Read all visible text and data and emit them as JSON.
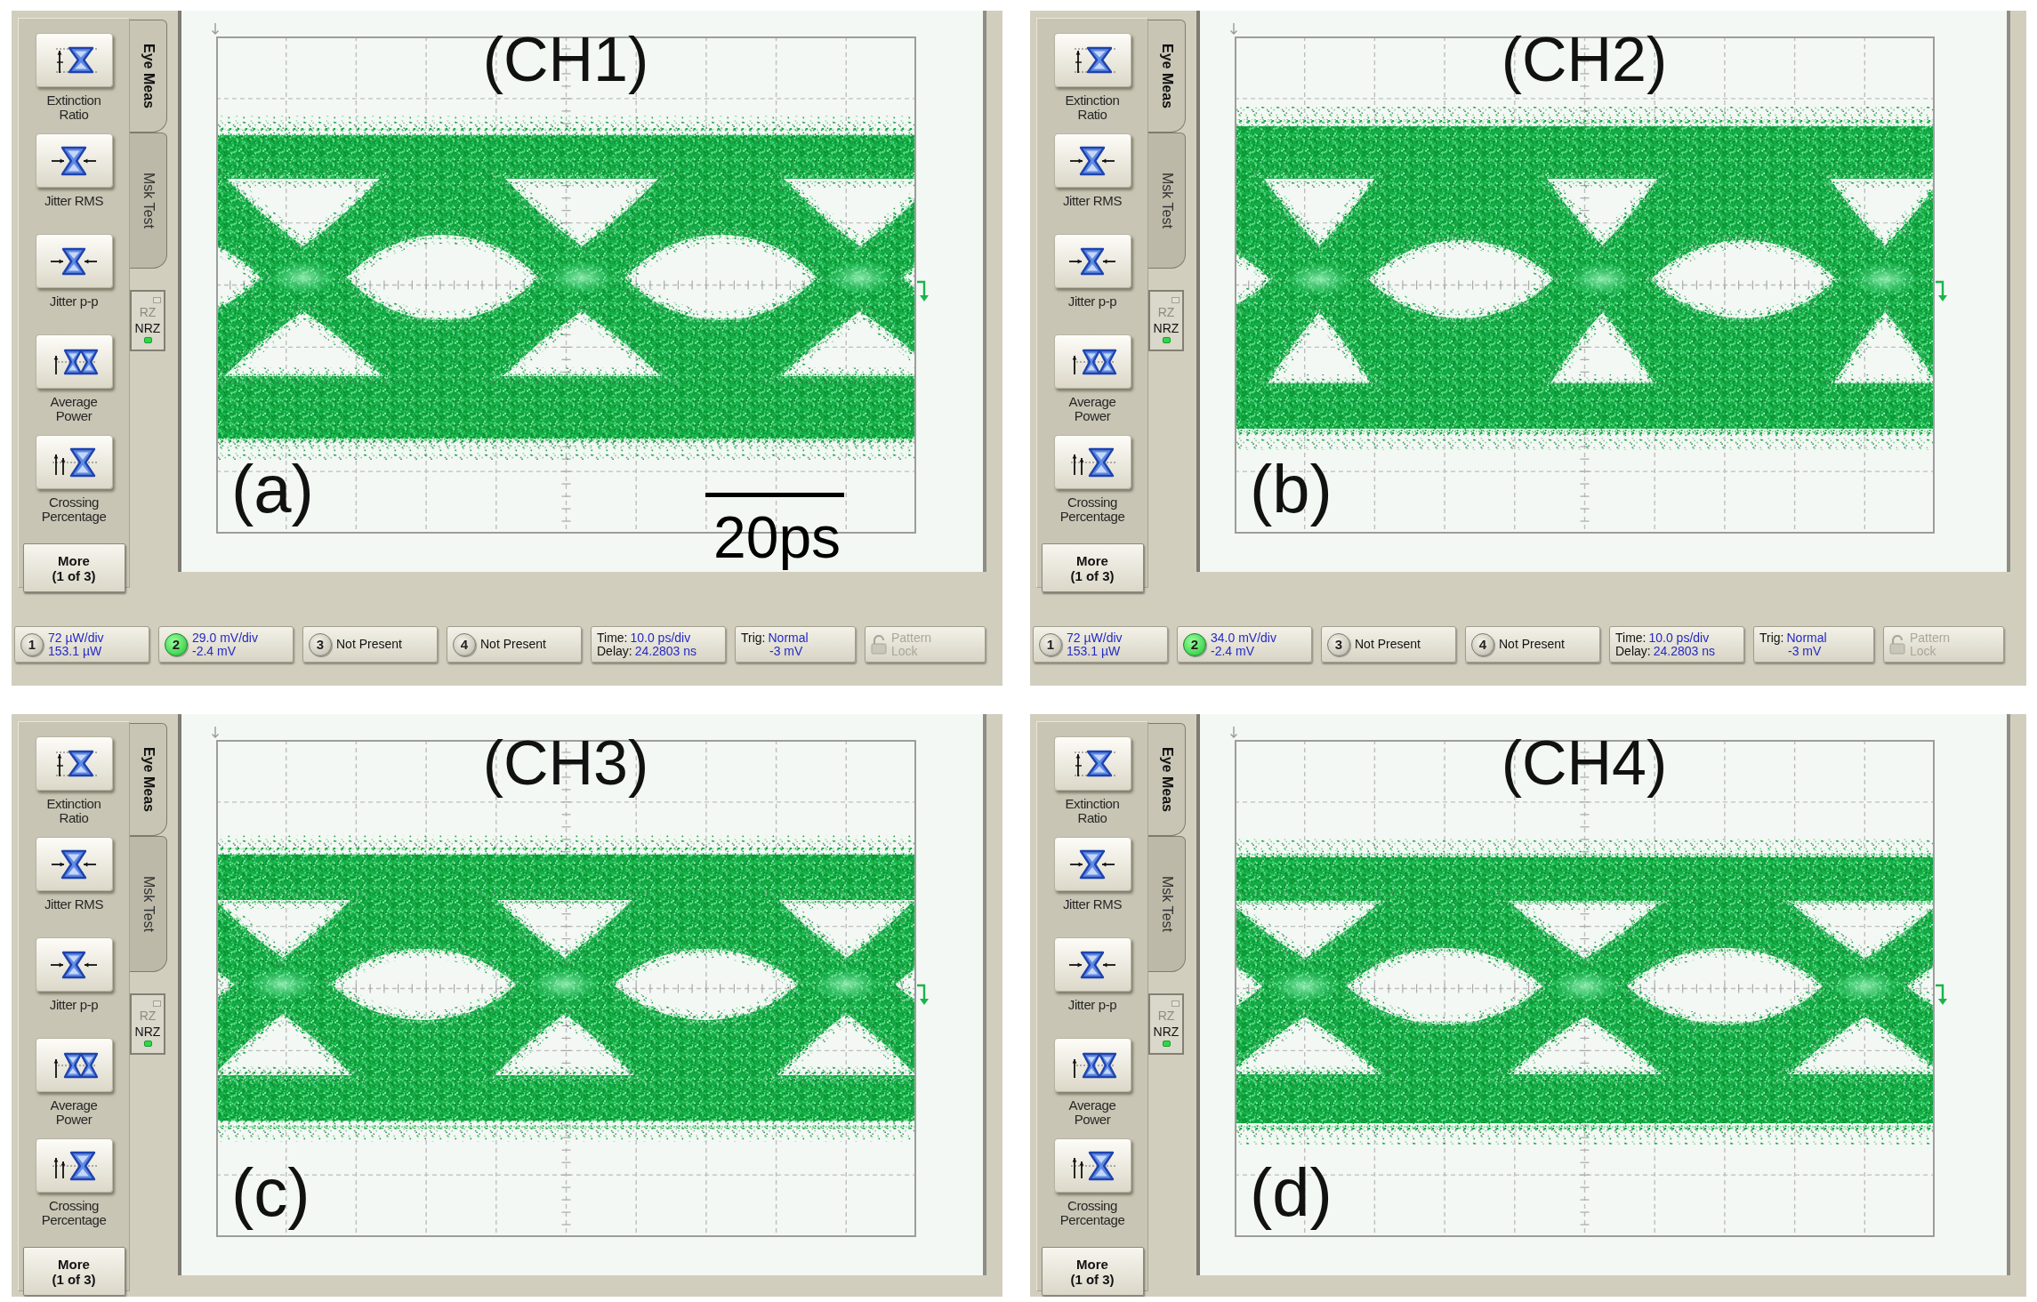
{
  "panels": [
    {
      "title": "(CH1)",
      "label": "(a)",
      "scale_bar": "20ps",
      "measurements": [
        {
          "label": "Extinction\nRatio"
        },
        {
          "label": "Jitter RMS"
        },
        {
          "label": "Jitter p-p"
        },
        {
          "label": "Average\nPower"
        },
        {
          "label": "Crossing\nPercentage"
        }
      ],
      "more_button": "More\n(1 of 3)",
      "tabs": [
        {
          "label": "Eye Meas",
          "selected": true
        },
        {
          "label": "Msk Test",
          "selected": false
        }
      ],
      "modes": [
        {
          "label": "RZ",
          "selected": false
        },
        {
          "label": "NRZ",
          "selected": true
        }
      ],
      "status_bar": [
        {
          "kind": "channel",
          "number": "1",
          "on": false,
          "scale": "72 µW/div",
          "offset": "153.1 µW"
        },
        {
          "kind": "channel",
          "number": "2",
          "on": true,
          "scale": "29.0 mV/div",
          "offset": "-2.4 mV"
        },
        {
          "kind": "channel",
          "number": "3",
          "on": false,
          "status": "Not Present"
        },
        {
          "kind": "channel",
          "number": "4",
          "on": false,
          "status": "Not Present"
        },
        {
          "kind": "timebase",
          "time_label": "Time:",
          "time": "10.0 ps/div",
          "delay_label": "Delay:",
          "delay": "24.2803 ns"
        },
        {
          "kind": "trigger",
          "label": "Trig:",
          "mode": "Normal",
          "trigger_level": "-3 mV"
        },
        {
          "kind": "lock",
          "label": "Pattern\nLock",
          "disabled": true
        }
      ]
    },
    {
      "title": "(CH2)",
      "label": "(b)",
      "measurements": [
        {
          "label": "Extinction\nRatio"
        },
        {
          "label": "Jitter RMS"
        },
        {
          "label": "Jitter p-p"
        },
        {
          "label": "Average\nPower"
        },
        {
          "label": "Crossing\nPercentage"
        }
      ],
      "more_button": "More\n(1 of 3)",
      "tabs": [
        {
          "label": "Eye Meas",
          "selected": true
        },
        {
          "label": "Msk Test",
          "selected": false
        }
      ],
      "modes": [
        {
          "label": "RZ",
          "selected": false
        },
        {
          "label": "NRZ",
          "selected": true
        }
      ],
      "status_bar": [
        {
          "kind": "channel",
          "number": "1",
          "on": false,
          "scale": "72 µW/div",
          "offset": "153.1 µW"
        },
        {
          "kind": "channel",
          "number": "2",
          "on": true,
          "scale": "34.0 mV/div",
          "offset": "-2.4 mV"
        },
        {
          "kind": "channel",
          "number": "3",
          "on": false,
          "status": "Not Present"
        },
        {
          "kind": "channel",
          "number": "4",
          "on": false,
          "status": "Not Present"
        },
        {
          "kind": "timebase",
          "time_label": "Time:",
          "time": "10.0 ps/div",
          "delay_label": "Delay:",
          "delay": "24.2803 ns"
        },
        {
          "kind": "trigger",
          "label": "Trig:",
          "mode": "Normal",
          "trigger_level": "-3 mV"
        },
        {
          "kind": "lock",
          "label": "Pattern\nLock",
          "disabled": true
        }
      ]
    },
    {
      "title": "(CH3)",
      "label": "(c)",
      "measurements": [
        {
          "label": "Extinction\nRatio"
        },
        {
          "label": "Jitter RMS"
        },
        {
          "label": "Jitter p-p"
        },
        {
          "label": "Average\nPower"
        },
        {
          "label": "Crossing\nPercentage"
        }
      ],
      "more_button": "More\n(1 of 3)",
      "tabs": [
        {
          "label": "Eye Meas",
          "selected": true
        },
        {
          "label": "Msk Test",
          "selected": false
        }
      ],
      "modes": [
        {
          "label": "RZ",
          "selected": false
        },
        {
          "label": "NRZ",
          "selected": true
        }
      ]
    },
    {
      "title": "(CH4)",
      "label": "(d)",
      "measurements": [
        {
          "label": "Extinction\nRatio"
        },
        {
          "label": "Jitter RMS"
        },
        {
          "label": "Jitter p-p"
        },
        {
          "label": "Average\nPower"
        },
        {
          "label": "Crossing\nPercentage"
        }
      ],
      "more_button": "More\n(1 of 3)",
      "tabs": [
        {
          "label": "Eye Meas",
          "selected": true
        },
        {
          "label": "Msk Test",
          "selected": false
        }
      ],
      "modes": [
        {
          "label": "RZ",
          "selected": false
        },
        {
          "label": "NRZ",
          "selected": true
        }
      ]
    }
  ]
}
